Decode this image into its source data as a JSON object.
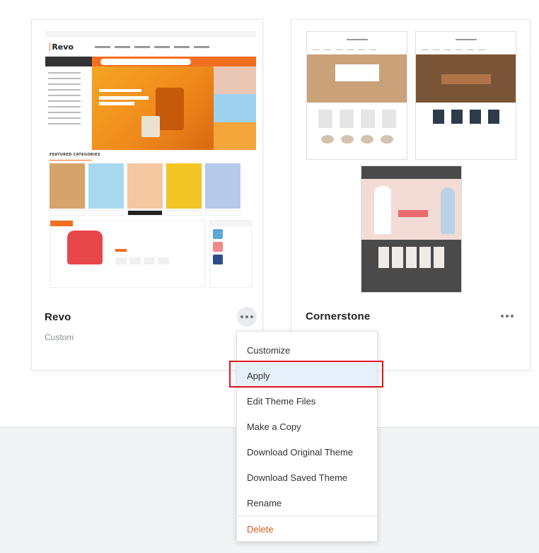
{
  "themes": [
    {
      "name": "Revo",
      "subtitle": "Custom",
      "thumbnail": {
        "logo_text": "Revo",
        "section_heading": "FEATURED CATEGORIES",
        "brand_color": "#f36f21"
      }
    },
    {
      "name": "Cornerstone",
      "subtitle": ""
    }
  ],
  "context_menu": {
    "items": [
      {
        "label": "Customize"
      },
      {
        "label": "Apply"
      },
      {
        "label": "Edit Theme Files"
      },
      {
        "label": "Make a Copy"
      },
      {
        "label": "Download Original Theme"
      },
      {
        "label": "Download Saved Theme"
      },
      {
        "label": "Rename"
      },
      {
        "label": "Delete"
      }
    ],
    "highlighted": "Apply"
  },
  "colors": {
    "highlight_border": "#e1141e",
    "menu_active_bg": "#e5f0fb",
    "delete_text": "#d65a1e"
  }
}
